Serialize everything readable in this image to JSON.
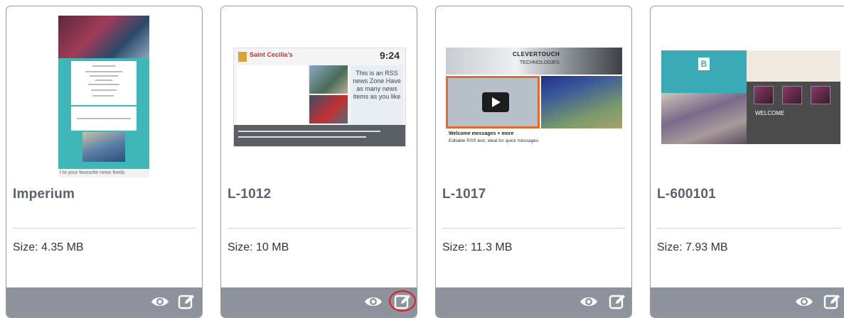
{
  "cards": [
    {
      "title": "Imperium",
      "size": "Size: 4.35 MB",
      "thumb_ticker": "t to your favourite news feeds"
    },
    {
      "title": "L-1012",
      "size": "Size: 10 MB",
      "thumb_name": "Saint Cecilia's",
      "thumb_time": "9:24",
      "thumb_rss": "This is an RSS news Zone Have as many news items as you like"
    },
    {
      "title": "L-1017",
      "size": "Size: 11.3 MB",
      "thumb_brand": "CLEVERTOUCH",
      "thumb_brand2": "TECHNOLOGIES",
      "thumb_caption1": "Welcome messages + more",
      "thumb_caption2": "Editable RSS text, ideal for quick messages"
    },
    {
      "title": "L-600101",
      "size": "Size: 7.93 MB",
      "thumb_welcome": "WELCOME"
    }
  ],
  "icons": {
    "view": "eye-icon",
    "edit": "edit-icon"
  },
  "colors": {
    "footer": "#8e929d",
    "title": "#5b6370",
    "highlight": "#e01b24"
  }
}
